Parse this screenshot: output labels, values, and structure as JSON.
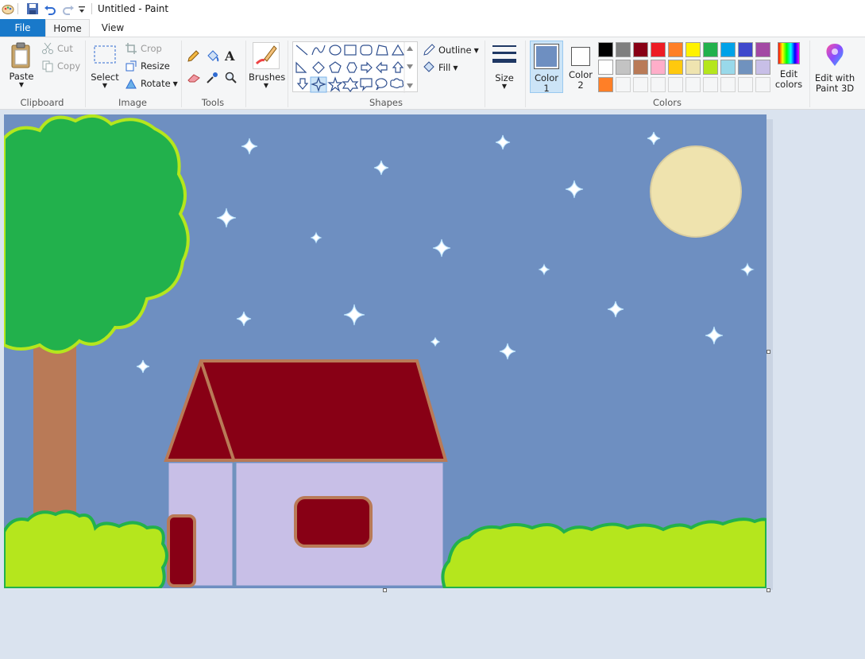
{
  "window": {
    "title": "Untitled - Paint"
  },
  "tabs": {
    "file": "File",
    "home": "Home",
    "view": "View"
  },
  "clipboard": {
    "paste": "Paste",
    "cut": "Cut",
    "copy": "Copy",
    "group": "Clipboard"
  },
  "image": {
    "select": "Select",
    "crop": "Crop",
    "resize": "Resize",
    "rotate": "Rotate",
    "group": "Image"
  },
  "tools": {
    "group": "Tools"
  },
  "brushes": {
    "label": "Brushes"
  },
  "shapes": {
    "outline": "Outline",
    "fill": "Fill",
    "group": "Shapes"
  },
  "size": {
    "label": "Size"
  },
  "colors": {
    "color1_label": "Color",
    "color1_num": "1",
    "color2_label": "Color",
    "color2_num": "2",
    "edit_label": "Edit",
    "edit_label2": "colors",
    "group": "Colors",
    "color1_value": "#6e8fc1",
    "color2_value": "#ffffff",
    "palette": [
      "#000000",
      "#7f7f7f",
      "#880015",
      "#ed1c24",
      "#ff7f27",
      "#fff200",
      "#22b14c",
      "#00a2e8",
      "#3f48cc",
      "#a349a4",
      "#ffffff",
      "#c3c3c3",
      "#b97a57",
      "#ffaec9",
      "#ffc90e",
      "#efe4b0",
      "#b5e61d",
      "#99d9ea",
      "#7092be",
      "#c8bfe7",
      "#ff7f27"
    ]
  },
  "paint3d": {
    "label": "Edit with",
    "label2": "Paint 3D"
  },
  "picture": {
    "sky": "#6e8fc1",
    "moon": "#efe3ae",
    "roof": "#880015",
    "roof_border": "#b97a57",
    "wall": "#c8bfe7",
    "tree_leaves": "#22b14c",
    "tree_outline": "#b5e61d",
    "trunk": "#b97a57",
    "bushes": "#b5e61d",
    "bush_outline": "#22b14c"
  }
}
